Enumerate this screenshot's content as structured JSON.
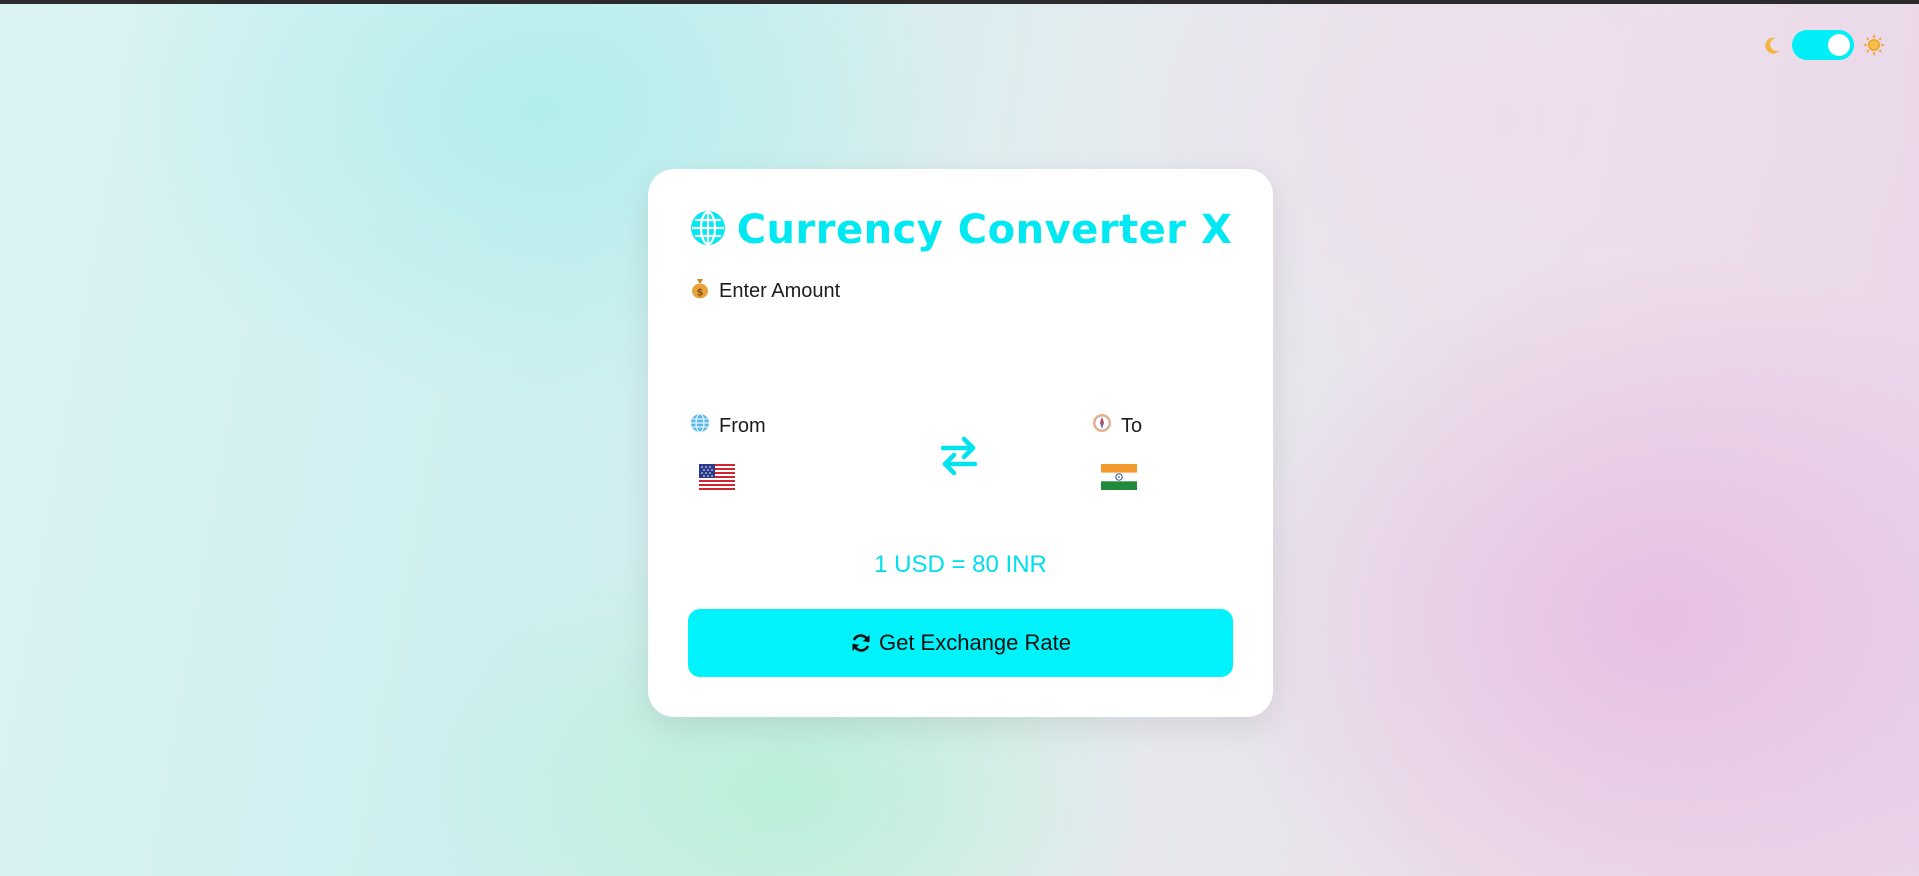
{
  "theme_toggle": {
    "moon_icon": "crescent-moon-icon",
    "sun_icon": "sun-icon",
    "state": "on",
    "track_color": "#00eef5"
  },
  "card": {
    "title_icon": "globe-icon",
    "title": "Currency Converter X",
    "amount": {
      "icon": "money-bag-icon",
      "label": "Enter Amount",
      "value": "",
      "placeholder": ""
    },
    "from": {
      "icon": "globe-meridians-icon",
      "label": "From",
      "flag": "us-flag-icon",
      "selected": "USD"
    },
    "swap_icon": "swap-arrows-icon",
    "to": {
      "icon": "compass-icon",
      "label": "To",
      "flag": "india-flag-icon",
      "selected": "INR"
    },
    "rate": "1 USD = 80 INR",
    "button": {
      "icon": "refresh-icon",
      "label": "Get Exchange Rate"
    }
  },
  "colors": {
    "accent": "#00f3fb",
    "title": "#00e9f2",
    "rate_text": "#00dfea",
    "card_bg": "#ffffff"
  }
}
